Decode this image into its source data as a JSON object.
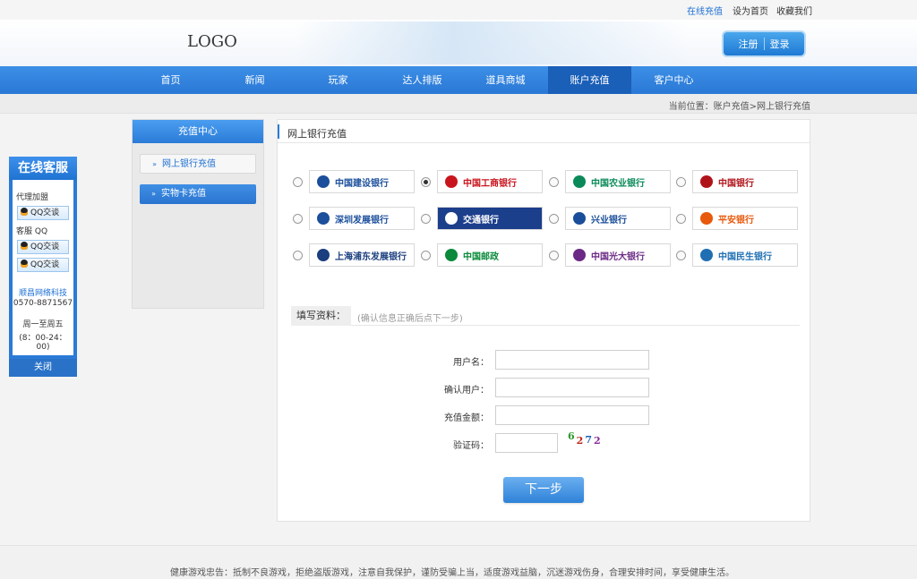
{
  "topbar": {
    "links": [
      "在线充值",
      "设为首页",
      "收藏我们"
    ]
  },
  "header": {
    "logo": "LOGO",
    "register": "注册",
    "login": "登录"
  },
  "nav": {
    "items": [
      "首页",
      "新闻",
      "玩家",
      "达人排版",
      "道具商城",
      "账户充值",
      "客户中心"
    ],
    "active": "账户充值"
  },
  "breadcrumb": "当前位置：账户充值>网上银行充值",
  "sidebar": {
    "title": "充值中心",
    "items": [
      "网上银行充值",
      "实物卡充值"
    ]
  },
  "main": {
    "title": "网上银行充值"
  },
  "banks": [
    {
      "name": "中国建设银行",
      "color": "#1b4f9c",
      "checked": false
    },
    {
      "name": "中国工商银行",
      "color": "#c8151d",
      "checked": true
    },
    {
      "name": "中国农业银行",
      "color": "#0a8a5a",
      "checked": false
    },
    {
      "name": "中国银行",
      "color": "#b0141b",
      "checked": false
    },
    {
      "name": "深圳发展银行",
      "color": "#1b4f9c",
      "checked": false
    },
    {
      "name": "交通银行",
      "color": "#ffffff",
      "checked": false
    },
    {
      "name": "兴业银行",
      "color": "#1a4e9a",
      "checked": false
    },
    {
      "name": "平安银行",
      "color": "#e8590c",
      "checked": false
    },
    {
      "name": "上海浦东发展银行",
      "color": "#1a3e7e",
      "checked": false
    },
    {
      "name": "中国邮政",
      "color": "#0a8a3a",
      "checked": false
    },
    {
      "name": "中国光大银行",
      "color": "#6b2a85",
      "checked": false
    },
    {
      "name": "中国民生银行",
      "color": "#1f6fb2",
      "checked": false
    }
  ],
  "form": {
    "section_label": "填写资料：",
    "hint": "(确认信息正确后点下一步)",
    "username_label": "用户名：",
    "confirm_label": "确认用户：",
    "amount_label": "充值金额：",
    "captcha_label": "验证码：",
    "captcha_chars": [
      "6",
      "2",
      "7",
      "2"
    ],
    "captcha_colors": [
      "#2a9a2a",
      "#c0281c",
      "#1d5fb8",
      "#8a2a9a"
    ],
    "next_button": "下一步"
  },
  "customer_service": {
    "title": "在线客服",
    "agent_label": "代理加盟",
    "service_label": "客服 QQ",
    "qq_label": "QQ交谈",
    "company": "顺昌网络科技",
    "phone": "0570-8871567",
    "days": "周一至周五",
    "hours": "(8：00-24：00)",
    "close": "关闭"
  },
  "footer": "健康游戏忠告：抵制不良游戏，拒绝盗版游戏，注意自我保护，谨防受骗上当，适度游戏益脑，沉迷游戏伤身，合理安排时间，享受健康生活。"
}
